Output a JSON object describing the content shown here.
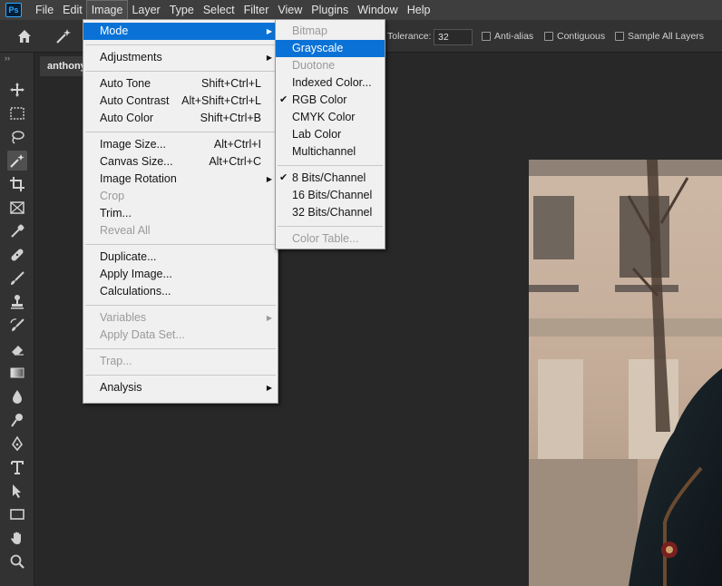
{
  "app": {
    "logo": "Ps"
  },
  "menubar": {
    "items": [
      "File",
      "Edit",
      "Image",
      "Layer",
      "Type",
      "Select",
      "Filter",
      "View",
      "Plugins",
      "Window",
      "Help"
    ],
    "active": "Image"
  },
  "options": {
    "tolerance_label": "Tolerance:",
    "tolerance_value": "32",
    "anti_alias_label": "Anti-alias",
    "contiguous_label": "Contiguous",
    "sample_all_layers_label": "Sample All Layers"
  },
  "panel": {
    "collapse_glyph": "››"
  },
  "document": {
    "tab_title": "anthony"
  },
  "image_menu": {
    "mode": "Mode",
    "adjustments": "Adjustments",
    "auto_tone": "Auto Tone",
    "auto_tone_sc": "Shift+Ctrl+L",
    "auto_contrast": "Auto Contrast",
    "auto_contrast_sc": "Alt+Shift+Ctrl+L",
    "auto_color": "Auto Color",
    "auto_color_sc": "Shift+Ctrl+B",
    "image_size": "Image Size...",
    "image_size_sc": "Alt+Ctrl+I",
    "canvas_size": "Canvas Size...",
    "canvas_size_sc": "Alt+Ctrl+C",
    "image_rotation": "Image Rotation",
    "crop": "Crop",
    "trim": "Trim...",
    "reveal_all": "Reveal All",
    "duplicate": "Duplicate...",
    "apply_image": "Apply Image...",
    "calculations": "Calculations...",
    "variables": "Variables",
    "apply_data_set": "Apply Data Set...",
    "trap": "Trap...",
    "analysis": "Analysis"
  },
  "mode_menu": {
    "bitmap": "Bitmap",
    "grayscale": "Grayscale",
    "duotone": "Duotone",
    "indexed_color": "Indexed Color...",
    "rgb_color": "RGB Color",
    "cmyk_color": "CMYK Color",
    "lab_color": "Lab Color",
    "multichannel": "Multichannel",
    "bits8": "8 Bits/Channel",
    "bits16": "16 Bits/Channel",
    "bits32": "32 Bits/Channel",
    "color_table": "Color Table...",
    "checked_mode": "RGB Color",
    "checked_depth": "8 Bits/Channel"
  },
  "colors": {
    "highlight": "#0a72d6",
    "menu_bg": "#f0f0f0",
    "app_bg": "#282828"
  }
}
